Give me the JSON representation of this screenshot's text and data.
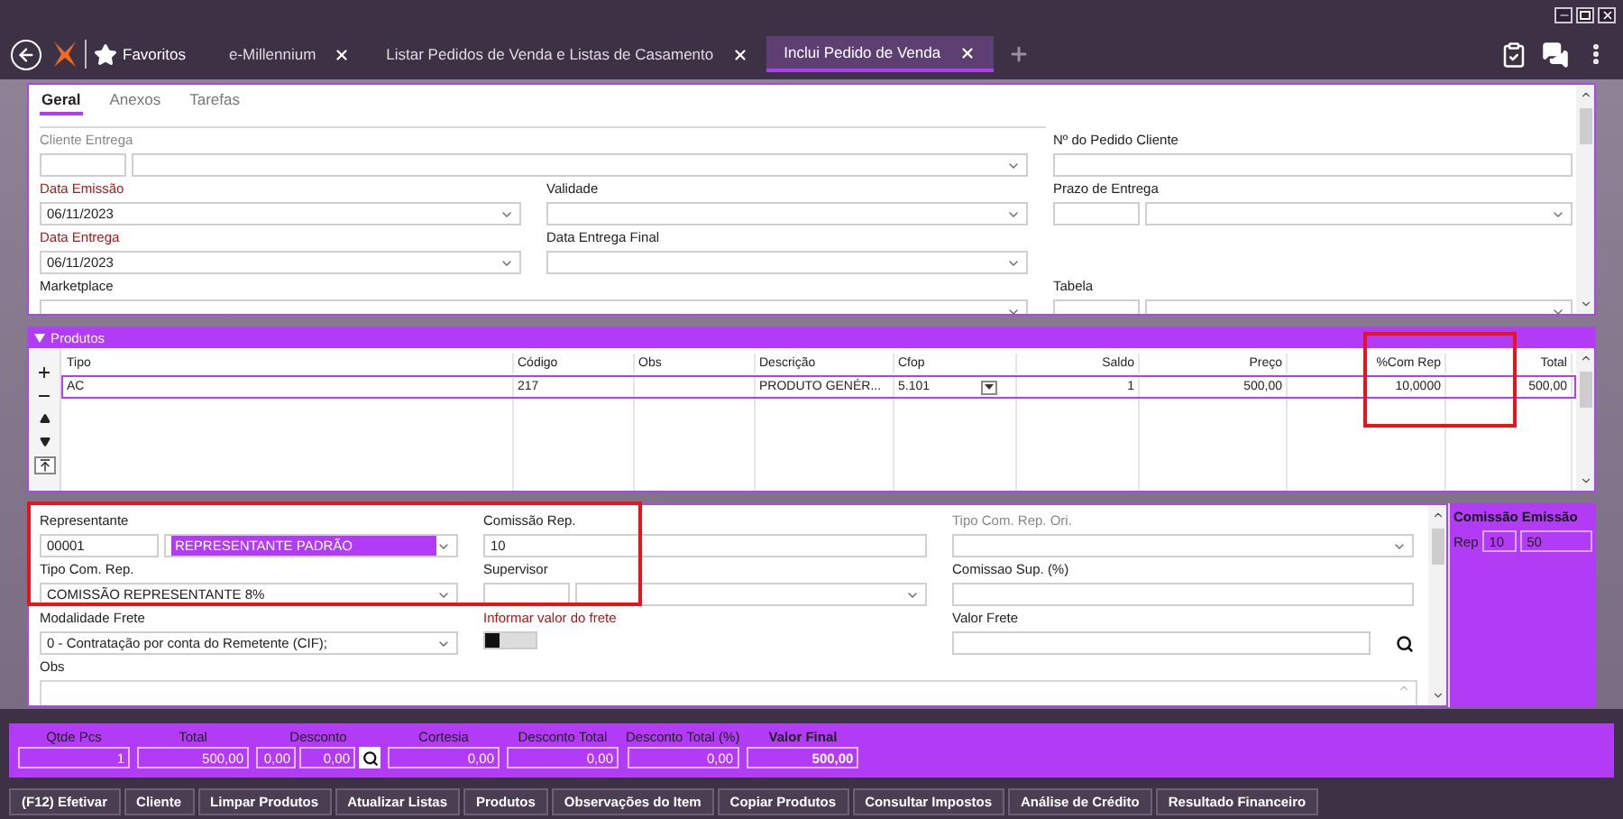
{
  "app_bar": {
    "favorites": "Favoritos",
    "tabs": [
      {
        "label": "e-Millennium",
        "selected": false
      },
      {
        "label": "Listar Pedidos de Venda e Listas de Casamento",
        "selected": false
      },
      {
        "label": "Inclui Pedido de Venda",
        "selected": true
      }
    ]
  },
  "form_tabs": [
    {
      "label": "Geral",
      "selected": true
    },
    {
      "label": "Anexos",
      "selected": false
    },
    {
      "label": "Tarefas",
      "selected": false
    }
  ],
  "header_form": {
    "rows": [
      {
        "wide": {
          "label": "Cliente Entrega",
          "required": false,
          "disabled": true,
          "kind": "split_select"
        },
        "right": {
          "label": "Nº do Pedido Cliente",
          "required": false,
          "disabled": false,
          "kind": "text"
        }
      },
      {
        "left": {
          "label": "Data Emissão",
          "required": true,
          "disabled": false,
          "kind": "select",
          "value": "06/11/2023"
        },
        "middle": {
          "label": "Validade",
          "required": false,
          "disabled": false,
          "kind": "select"
        },
        "right": {
          "label": "Prazo de Entrega",
          "required": false,
          "disabled": false,
          "kind": "split_select"
        }
      },
      {
        "left": {
          "label": "Data Entrega",
          "required": true,
          "disabled": false,
          "kind": "select",
          "value": "06/11/2023"
        },
        "middle": {
          "label": "Data Entrega Final",
          "required": false,
          "disabled": false,
          "kind": "select"
        }
      },
      {
        "wide": {
          "label": "Marketplace",
          "required": false,
          "disabled": false,
          "kind": "select"
        },
        "right": {
          "label": "Tabela",
          "required": false,
          "disabled": false,
          "kind": "split_select"
        }
      }
    ]
  },
  "products": {
    "title": "Produtos",
    "expanded": true,
    "columns": [
      {
        "label": "Tipo",
        "numeric": false
      },
      {
        "label": "Código",
        "numeric": false
      },
      {
        "label": "Obs",
        "numeric": false
      },
      {
        "label": "Descrição",
        "numeric": false
      },
      {
        "label": "Cfop",
        "numeric": false,
        "kind": "dropdown"
      },
      {
        "label": "Saldo",
        "numeric": true
      },
      {
        "label": "Preço",
        "numeric": true
      },
      {
        "label": "%Com Rep",
        "numeric": true
      },
      {
        "label": "Total",
        "numeric": true
      }
    ],
    "rows": [
      {
        "selected": true,
        "cells": [
          "AC",
          "217",
          "",
          "PRODUTO GENÉR...",
          "5.101",
          "1",
          "500,00",
          "10,0000",
          "500,00"
        ]
      }
    ]
  },
  "commission_form": {
    "rows": [
      {
        "left": {
          "label": "Representante",
          "required": false,
          "disabled": false,
          "kind": "split_select",
          "value": "00001",
          "value_2": "REPRESENTANTE PADRÃO",
          "selected": true
        },
        "middle": {
          "label": "Comissão Rep.",
          "required": false,
          "disabled": false,
          "kind": "text",
          "value": "10"
        },
        "right": {
          "label": "Tipo Com. Rep. Ori.",
          "required": false,
          "disabled": true,
          "kind": "select"
        }
      },
      {
        "left": {
          "label": "Tipo Com. Rep.",
          "required": false,
          "disabled": false,
          "kind": "select",
          "value": "COMISSÃO REPRESENTANTE 8%"
        },
        "middle": {
          "label": "Supervisor",
          "required": false,
          "disabled": false,
          "kind": "split_select"
        },
        "right": {
          "label": "Comissao Sup. (%)",
          "required": false,
          "disabled": false,
          "kind": "text"
        }
      },
      {
        "left": {
          "label": "Modalidade Frete",
          "required": false,
          "disabled": false,
          "kind": "select",
          "value": "0 - Contratação por conta do Remetente (CIF);"
        },
        "middle": {
          "label": "Informar valor do frete",
          "required": true,
          "disabled": false,
          "kind": "toggle",
          "on": false
        },
        "right": {
          "label": "Valor Frete",
          "required": false,
          "disabled": false,
          "kind": "search_text"
        }
      }
    ],
    "notes_label": "Obs"
  },
  "emission_panel": {
    "title": "Comissão Emissão",
    "label": "Rep",
    "values": [
      "10",
      "50"
    ]
  },
  "totals": [
    {
      "label": "Qtde Pcs",
      "kind": "plain",
      "values": [
        "1"
      ]
    },
    {
      "label": "Total",
      "kind": "plain",
      "values": [
        "500,00"
      ]
    },
    {
      "label": "Desconto",
      "kind": "search",
      "values": [
        "0,00",
        "0,00"
      ]
    },
    {
      "label": "Cortesia",
      "kind": "plain",
      "values": [
        "0,00"
      ]
    },
    {
      "label": "Desconto Total",
      "kind": "plain",
      "values": [
        "0,00"
      ]
    },
    {
      "label": "Desconto Total (%)",
      "kind": "plain",
      "values": [
        "0,00"
      ]
    },
    {
      "label": "Valor Final",
      "kind": "final",
      "values": [
        "500,00"
      ]
    }
  ],
  "actions": [
    "(F12) Efetivar",
    "Cliente",
    "Limpar Produtos",
    "Atualizar Listas",
    "Produtos",
    "Observações do Item",
    "Copiar Produtos",
    "Consultar Impostos",
    "Análise de Crédito",
    "Resultado Financeiro"
  ],
  "highlights": {
    "commission_column": true,
    "representative_fields": true
  }
}
